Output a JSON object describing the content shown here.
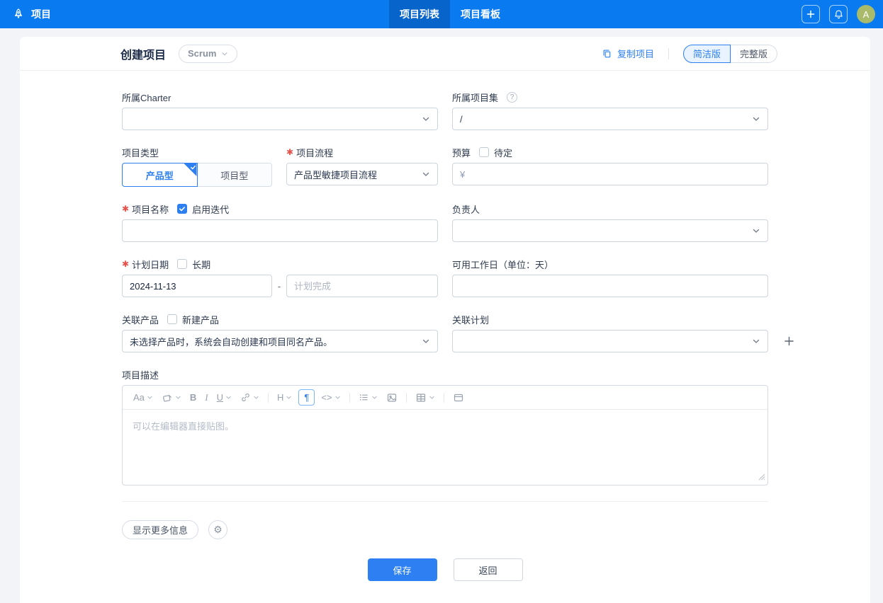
{
  "colors": {
    "primary": "#2e80f2",
    "topbar": "#0a7af0",
    "topbar_active_tab": "#0764ca",
    "avatar_bg": "#a9ba6b",
    "required_mark": "#e5534b",
    "view_toggle_active_bg": "#e9f3ff"
  },
  "topbar": {
    "app_title": "项目",
    "tabs": [
      {
        "label": "项目列表",
        "active": true
      },
      {
        "label": "项目看板",
        "active": false
      }
    ],
    "avatar_text": "A"
  },
  "header": {
    "title": "创建项目",
    "framework_selector": "Scrum",
    "copy_project": "复制项目",
    "view_toggle": {
      "simple": "简洁版",
      "full": "完整版",
      "active": "简洁版"
    }
  },
  "form": {
    "charter": {
      "label": "所属Charter",
      "value": ""
    },
    "program": {
      "label": "所属项目集",
      "value": "/"
    },
    "project_type": {
      "label": "项目类型",
      "options": [
        "产品型",
        "项目型"
      ],
      "selected": "产品型"
    },
    "process": {
      "label": "项目流程",
      "required": true,
      "value": "产品型敏捷项目流程"
    },
    "budget": {
      "label": "预算",
      "pending_checkbox": "待定",
      "pending_checked": false,
      "currency_symbol": "¥",
      "value": ""
    },
    "project_name": {
      "label": "项目名称",
      "required": true,
      "iteration_checkbox": "启用迭代",
      "iteration_checked": true,
      "value": ""
    },
    "owner": {
      "label": "负责人",
      "value": ""
    },
    "plan_date": {
      "label": "计划日期",
      "required": true,
      "longterm_checkbox": "长期",
      "longterm_checked": false,
      "begin_value": "2024-11-13",
      "separator": "-",
      "end_placeholder": "计划完成"
    },
    "workdays": {
      "label": "可用工作日（单位：天）",
      "value": ""
    },
    "product": {
      "label": "关联产品",
      "new_checkbox": "新建产品",
      "new_checked": false,
      "text": "未选择产品时，系统会自动创建和项目同名产品。"
    },
    "plan": {
      "label": "关联计划",
      "value": ""
    },
    "description": {
      "label": "项目描述",
      "placeholder": "可以在编辑器直接贴图。"
    }
  },
  "editor_toolbar": {
    "font": "Aa",
    "bold": "B",
    "italic": "I",
    "underline": "U",
    "heading": "H",
    "paragraph": "¶",
    "code": "<>"
  },
  "footer": {
    "show_more": "显示更多信息",
    "save": "保存",
    "back": "返回"
  }
}
